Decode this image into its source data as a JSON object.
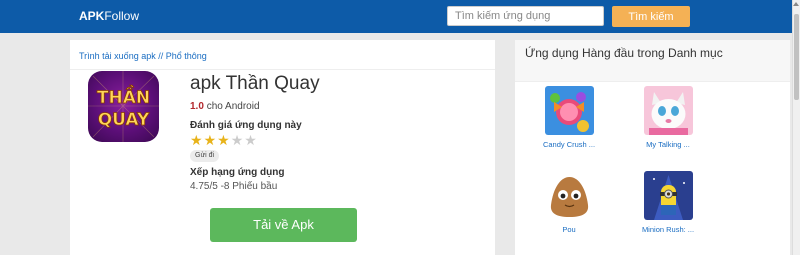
{
  "header": {
    "logo_bold": "APK",
    "logo_regular": "Follow",
    "search_placeholder": "Tìm kiếm ứng dụng",
    "search_button": "Tìm kiếm"
  },
  "breadcrumb": {
    "item1": "Trình tải xuống apk",
    "separator": " // ",
    "item2": "Phổ thông"
  },
  "app": {
    "title": "apk Thần Quay",
    "icon_text_line1": "THẦN",
    "icon_text_line2": "QUAY",
    "version": "1.0",
    "platform": "cho Android",
    "rate_label": "Đánh giá ứng dụng này",
    "rating_stars": 3,
    "rating_max": 5,
    "send_label": "Gửi đi",
    "rank_label": "Xếp hạng ứng dụng",
    "rank_value": "4.75/5 -8 Phiếu bầu",
    "download_label": "Tải về Apk"
  },
  "sidebar": {
    "title": "Ứng dụng Hàng đầu trong Danh mục",
    "apps": [
      {
        "label": "Candy Crush ...",
        "icon": "candy-crush-icon"
      },
      {
        "label": "My Talking ...",
        "icon": "talking-angela-icon"
      },
      {
        "label": "Pou",
        "icon": "pou-icon"
      },
      {
        "label": "Minion Rush: ...",
        "icon": "minion-rush-icon"
      }
    ]
  },
  "colors": {
    "header_bg": "#0d5ba8",
    "search_button_bg": "#f4b155",
    "download_button_bg": "#5cb85c",
    "link": "#1a6dc2",
    "version": "#b3282d",
    "star_filled": "#e8b31a"
  }
}
